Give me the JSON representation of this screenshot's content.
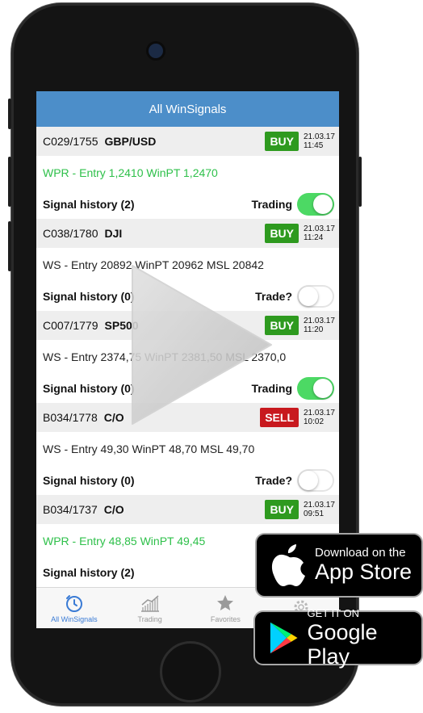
{
  "app": {
    "title": "All WinSignals"
  },
  "signals": [
    {
      "code": "C029/1755",
      "symbol": "GBP/USD",
      "action": "BUY",
      "action_color": "#2e9a1f",
      "date": "21.03.17",
      "time": "11:45",
      "entry": "WPR - Entry 1,2410 WinPT 1,2470",
      "entry_color": "green",
      "history": "Signal history (2)",
      "trade_label": "Trading",
      "trade_on": true
    },
    {
      "code": "C038/1780",
      "symbol": "DJI",
      "action": "BUY",
      "action_color": "#2e9a1f",
      "date": "21.03.17",
      "time": "11:24",
      "entry": "WS - Entry 20892 WinPT 20962 MSL 20842",
      "entry_color": "dark",
      "history": "Signal history (0)",
      "trade_label": "Trade?",
      "trade_on": false
    },
    {
      "code": "C007/1779",
      "symbol": "SP500",
      "action": "BUY",
      "action_color": "#2e9a1f",
      "date": "21.03.17",
      "time": "11:20",
      "entry": "WS - Entry 2374,75 WinPT 2381,50 MSL 2370,0",
      "entry_color": "dark",
      "history": "Signal history (0)",
      "trade_label": "Trading",
      "trade_on": true
    },
    {
      "code": "B034/1778",
      "symbol": "C/O",
      "action": "SELL",
      "action_color": "#c8191e",
      "date": "21.03.17",
      "time": "10:02",
      "entry": "WS - Entry 49,30 WinPT 48,70 MSL 49,70",
      "entry_color": "dark",
      "history": "Signal history (0)",
      "trade_label": "Trade?",
      "trade_on": false
    },
    {
      "code": "B034/1737",
      "symbol": "C/O",
      "action": "BUY",
      "action_color": "#2e9a1f",
      "date": "21.03.17",
      "time": "09:51",
      "entry": "WPR - Entry 48,85 WinPT 49,45",
      "entry_color": "green",
      "history": "Signal history (2)",
      "trade_label": "",
      "trade_on": null
    }
  ],
  "tabs": [
    {
      "label": "All WinSignals",
      "icon": "clock-icon",
      "active": true
    },
    {
      "label": "Trading",
      "icon": "chart-icon",
      "active": false
    },
    {
      "label": "Favorites",
      "icon": "star-icon",
      "active": false
    },
    {
      "label": "",
      "icon": "gear-icon",
      "active": false
    }
  ],
  "badges": {
    "apple_small": "Download on the",
    "apple_big": "App Store",
    "google_small": "GET IT ON",
    "google_big": "Google Play"
  },
  "colors": {
    "titlebar": "#4c8ec9",
    "buy": "#2e9a1f",
    "sell": "#c8191e",
    "entry_green": "#2ec04a",
    "toggle_on": "#4cd964",
    "tab_active": "#3a7bd5"
  }
}
